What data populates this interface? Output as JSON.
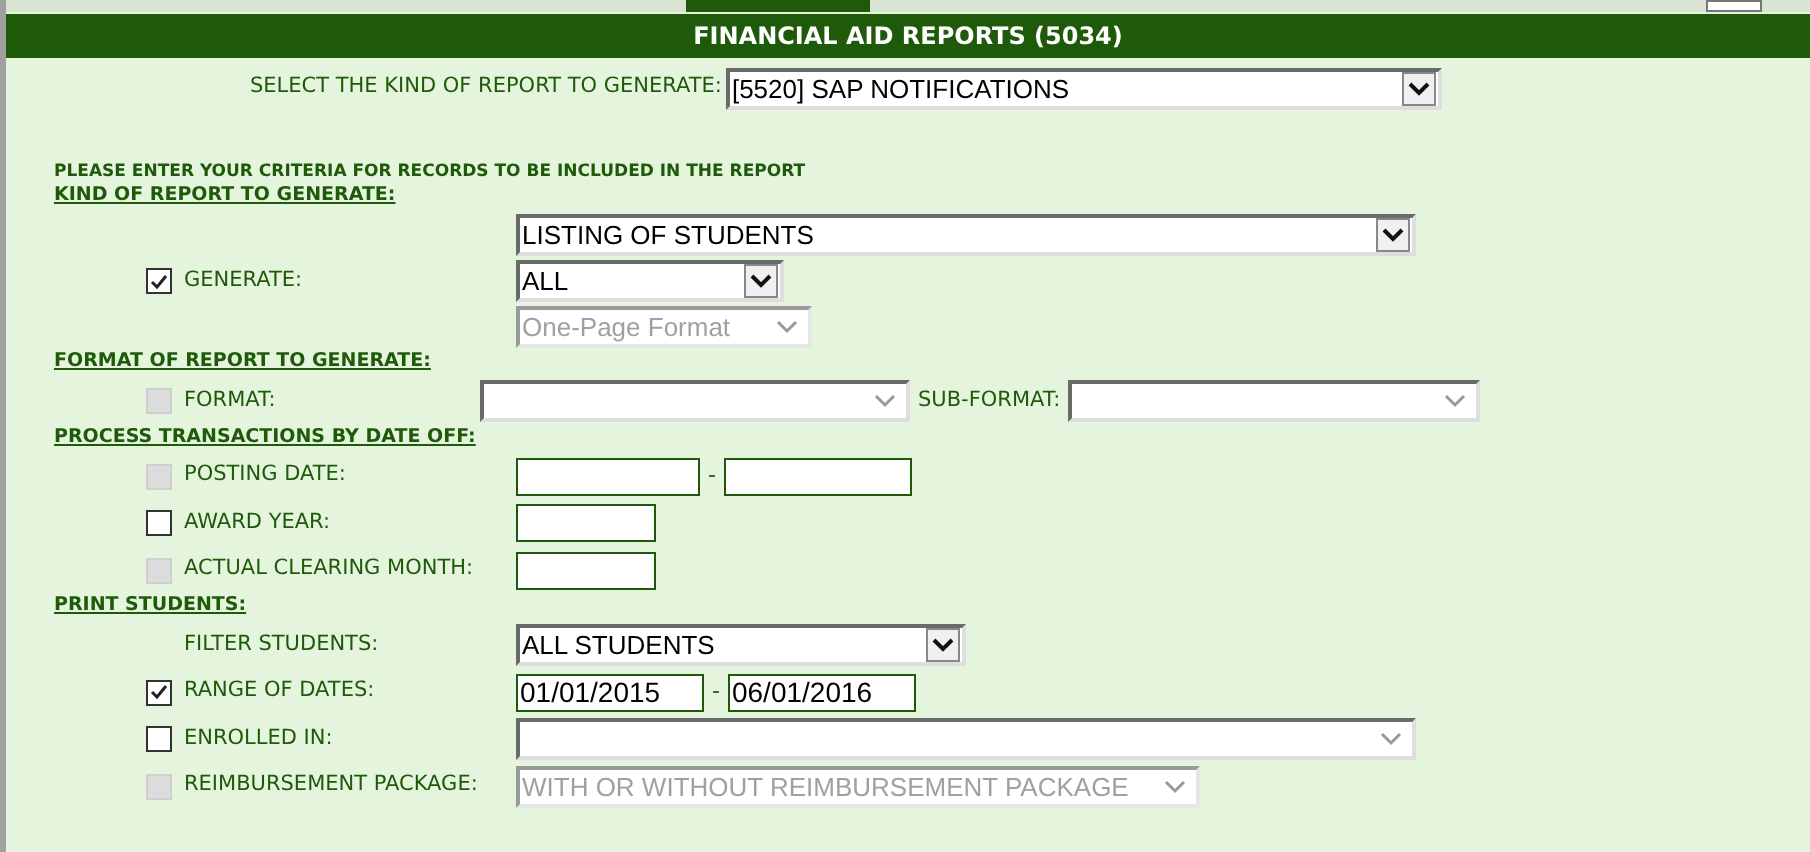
{
  "header": {
    "title": "FINANCIAL AID REPORTS (5034)"
  },
  "report_kind": {
    "label": "SELECT THE KIND OF REPORT TO GENERATE:",
    "value": "[5520] SAP NOTIFICATIONS"
  },
  "instructions": "PLEASE ENTER YOUR CRITERIA FOR RECORDS TO BE INCLUDED IN THE REPORT",
  "sections": [
    {
      "title": "KIND OF REPORT TO GENERATE:",
      "rows": [
        {
          "kind": "check",
          "label": "GENERATE:",
          "checked": true,
          "disabled": false,
          "controls": [
            {
              "kind": "select",
              "value": "LISTING OF STUDENTS",
              "disabled": false
            },
            {
              "kind": "select",
              "value": "ALL",
              "disabled": false
            },
            {
              "kind": "select",
              "value": "One-Page Format",
              "disabled": true
            }
          ]
        }
      ]
    },
    {
      "title": "FORMAT OF REPORT TO GENERATE:",
      "rows": [
        {
          "kind": "check",
          "label": "FORMAT:",
          "checked": false,
          "disabled": true,
          "controls": [
            {
              "kind": "select",
              "disabled": false
            },
            {
              "kind": "label",
              "text": "SUB-FORMAT:"
            },
            {
              "kind": "select",
              "disabled": false
            }
          ]
        }
      ]
    },
    {
      "title": "PROCESS TRANSACTIONS BY DATE OFF:",
      "rows": [
        {
          "kind": "check",
          "label": "POSTING DATE:",
          "checked": false,
          "disabled": true,
          "controls": [
            {
              "kind": "text"
            },
            {
              "kind": "dash",
              "text": "-"
            },
            {
              "kind": "text"
            }
          ]
        },
        {
          "kind": "check",
          "label": "AWARD YEAR:",
          "checked": false,
          "disabled": false,
          "controls": [
            {
              "kind": "text"
            }
          ]
        },
        {
          "kind": "check",
          "label": "ACTUAL CLEARING MONTH:",
          "checked": false,
          "disabled": true,
          "controls": [
            {
              "kind": "text"
            }
          ]
        }
      ]
    },
    {
      "title": "PRINT STUDENTS:",
      "rows": [
        {
          "kind": "plain",
          "label": "FILTER STUDENTS:",
          "controls": [
            {
              "kind": "select",
              "value": "ALL STUDENTS",
              "disabled": false
            }
          ]
        },
        {
          "kind": "check",
          "label": "RANGE OF DATES:",
          "checked": true,
          "disabled": false,
          "controls": [
            {
              "kind": "text",
              "value": "01/01/2015"
            },
            {
              "kind": "dash",
              "text": "-"
            },
            {
              "kind": "text",
              "value": "06/01/2016"
            }
          ]
        },
        {
          "kind": "check",
          "label": "ENROLLED IN:",
          "checked": false,
          "disabled": false,
          "controls": [
            {
              "kind": "select",
              "disabled": false
            }
          ]
        },
        {
          "kind": "check",
          "label": "REIMBURSEMENT PACKAGE:",
          "checked": false,
          "disabled": true,
          "controls": [
            {
              "kind": "select",
              "value": "WITH OR WITHOUT REIMBURSEMENT PACKAGE",
              "disabled": true
            }
          ]
        }
      ]
    }
  ]
}
